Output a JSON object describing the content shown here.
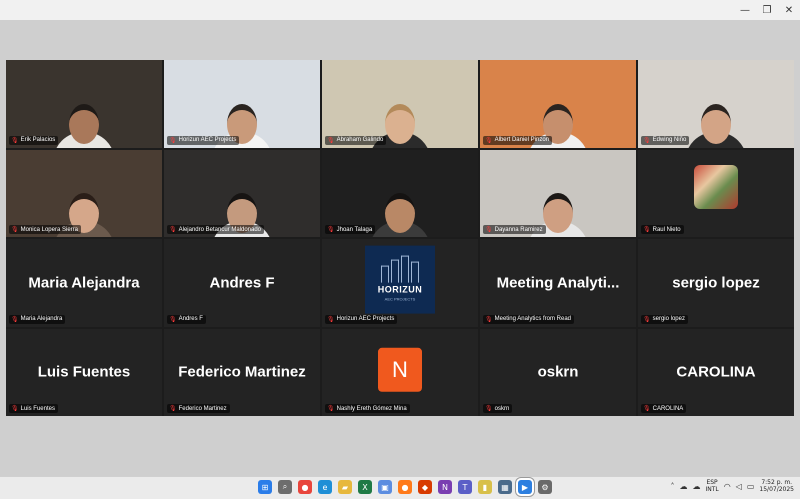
{
  "window": {
    "controls": [
      "—",
      "❐",
      "✕"
    ]
  },
  "tiles": [
    {
      "kind": "video",
      "name": "Erik Palacios",
      "bg": "#3a342e",
      "skin": "#a9785a",
      "shirt": "#e8e6e2",
      "hair": "#1e1a17"
    },
    {
      "kind": "video",
      "name": "Horizun AEC Projects",
      "bg": "#d8dde3",
      "skin": "#c99a7a",
      "shirt": "#f4f4f4",
      "hair": "#2a2420",
      "active": true
    },
    {
      "kind": "video",
      "name": "Abraham Galindo",
      "bg": "#cfc7b2",
      "skin": "#dbb190",
      "shirt": "#2b2b2b",
      "hair": "#b38a5a"
    },
    {
      "kind": "video",
      "name": "Albert Daniel Pinzon",
      "bg": "#d9834a",
      "skin": "#c68f6d",
      "shirt": "#f0f0f0",
      "hair": "#2b2420"
    },
    {
      "kind": "video",
      "name": "Edwing Niño",
      "bg": "#d6d2cc",
      "skin": "#d3a486",
      "shirt": "#2a2a2a",
      "hair": "#2b2420"
    },
    {
      "kind": "video",
      "name": "Monica Lopera Sierra",
      "bg": "#4a3d33",
      "skin": "#d5a78a",
      "shirt": "#6b5a4d",
      "hair": "#2a1e18"
    },
    {
      "kind": "video",
      "name": "Alejandro Betancur Maldonado",
      "bg": "#2f2d2c",
      "skin": "#c49a7e",
      "shirt": "#e9e9e9",
      "hair": "#171413"
    },
    {
      "kind": "video",
      "name": "Jhoan Talaga",
      "bg": "#1f1f1f",
      "skin": "#b98866",
      "shirt": "#3b3b3b",
      "hair": "#151312"
    },
    {
      "kind": "video",
      "name": "Dayanna Ramirez",
      "bg": "#c9c6c1",
      "skin": "#cf9f82",
      "shirt": "#e7e7e7",
      "hair": "#1c1816"
    },
    {
      "kind": "photo",
      "name": "Raul Nieto"
    },
    {
      "kind": "text",
      "label": "Maria Alejandra",
      "name": "Maria Alejandra"
    },
    {
      "kind": "text",
      "label": "Andres F",
      "name": "Andres F"
    },
    {
      "kind": "logo",
      "name": "Horizun AEC Projects",
      "logo_word": "HORIZUN",
      "logo_sub": "AEC PROJECTS"
    },
    {
      "kind": "text",
      "label": "Meeting  Analyti...",
      "name": "Meeting Analytics from Read"
    },
    {
      "kind": "text",
      "label": "sergio lopez",
      "name": "sergio lopez"
    },
    {
      "kind": "text",
      "label": "Luis Fuentes",
      "name": "Luis Fuentes"
    },
    {
      "kind": "text",
      "label": "Federico Martinez",
      "name": "Federico Martinez"
    },
    {
      "kind": "avatar",
      "initial": "N",
      "name": "Nashly Ereth Gómez Mina"
    },
    {
      "kind": "text",
      "label": "oskrn",
      "name": "oskrn"
    },
    {
      "kind": "text",
      "label": "CAROLINA",
      "name": "CAROLINA"
    }
  ],
  "taskbar": {
    "apps": [
      {
        "id": "start-icon",
        "glyph": "⊞",
        "color": "#2b7de9"
      },
      {
        "id": "search-icon",
        "glyph": "⌕",
        "color": "#6d6d6d"
      },
      {
        "id": "chrome-icon",
        "glyph": "●",
        "color": "#e8453c"
      },
      {
        "id": "edge-icon",
        "glyph": "e",
        "color": "#1f8fd6"
      },
      {
        "id": "explorer-icon",
        "glyph": "▰",
        "color": "#e7b83d"
      },
      {
        "id": "excel-icon",
        "glyph": "X",
        "color": "#1f7a45"
      },
      {
        "id": "store-icon",
        "glyph": "▣",
        "color": "#5c8de0"
      },
      {
        "id": "firefox-icon",
        "glyph": "●",
        "color": "#ff7a1a"
      },
      {
        "id": "office-icon",
        "glyph": "◆",
        "color": "#d83b01"
      },
      {
        "id": "onenote-icon",
        "glyph": "N",
        "color": "#7a3eb1"
      },
      {
        "id": "teams-icon",
        "glyph": "T",
        "color": "#5b5fc7"
      },
      {
        "id": "sticky-notes-icon",
        "glyph": "▮",
        "color": "#d8c04a"
      },
      {
        "id": "calculator-icon",
        "glyph": "▦",
        "color": "#4a6a8a"
      },
      {
        "id": "zoom-icon",
        "glyph": "▶",
        "color": "#2d7fe0",
        "active": true
      },
      {
        "id": "settings-icon",
        "glyph": "⚙",
        "color": "#6a6a6a"
      }
    ],
    "tray": {
      "language": "ESP",
      "layout": "INTL",
      "time": "7:52 p. m.",
      "date": "15/07/2025"
    }
  }
}
